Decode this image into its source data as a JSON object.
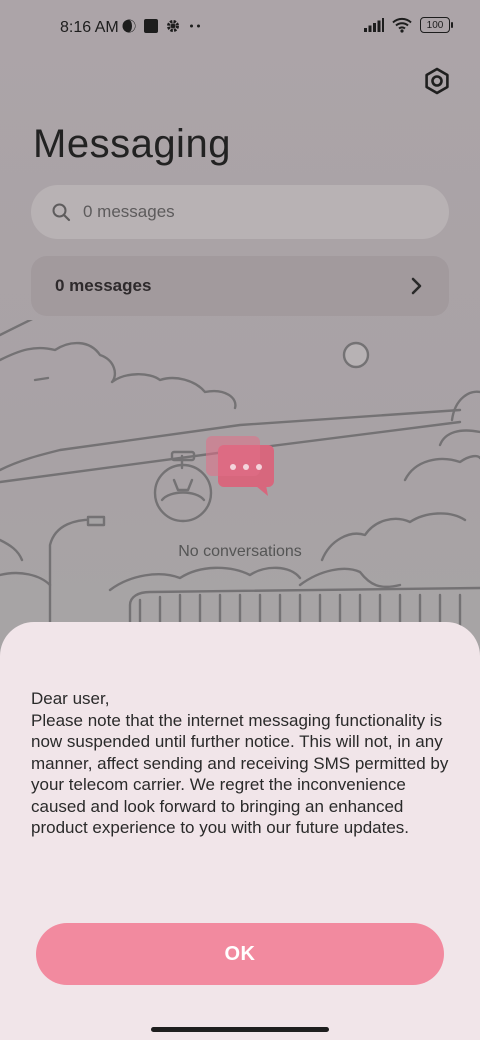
{
  "status_bar": {
    "time": "8:16 AM",
    "battery": "100"
  },
  "header": {
    "title": "Messaging"
  },
  "search": {
    "placeholder": "0 messages"
  },
  "summary_row": {
    "label": "0 messages"
  },
  "empty_state": {
    "text": "No conversations"
  },
  "dialog": {
    "message": "Dear user,\nPlease note that the internet messaging functionality is now suspended until further notice. This will not, in any manner, affect sending and receiving SMS permitted by your telecom carrier. We regret the inconvenience caused and look forward to bringing an enhanced product experience to you with our future updates.",
    "ok_label": "OK"
  },
  "colors": {
    "accent": "#f28a9f",
    "sheet_bg": "#f1e5e9",
    "overlay_bg": "#a9a3a6"
  },
  "icons": [
    "moon-icon",
    "app-icon",
    "gear-icon",
    "more-icon",
    "signal-icon",
    "wifi-icon",
    "battery-icon",
    "settings-icon",
    "search-icon",
    "chevron-right-icon",
    "chat-bubble-icon"
  ]
}
